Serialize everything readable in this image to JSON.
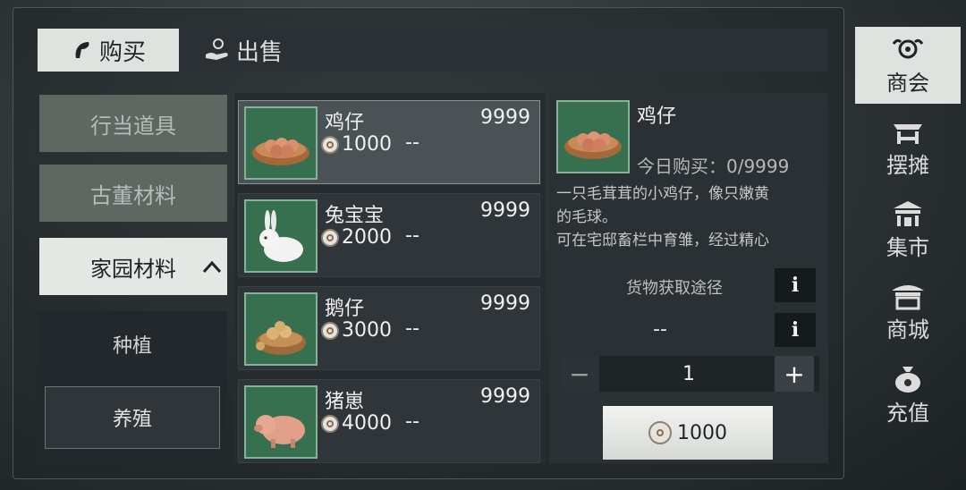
{
  "tabs": {
    "buy": "购买",
    "sell": "出售"
  },
  "categories": [
    {
      "label": "行当道具"
    },
    {
      "label": "古董材料"
    },
    {
      "label": "家园材料",
      "chevron": "^"
    }
  ],
  "subcategories": [
    {
      "label": "种植"
    },
    {
      "label": "养殖"
    }
  ],
  "items": [
    {
      "name": "鸡仔",
      "count": "9999",
      "price": "1000",
      "extra": "--"
    },
    {
      "name": "兔宝宝",
      "count": "9999",
      "price": "2000",
      "extra": "--"
    },
    {
      "name": "鹅仔",
      "count": "9999",
      "price": "3000",
      "extra": "--"
    },
    {
      "name": "猪崽",
      "count": "9999",
      "price": "4000",
      "extra": "--"
    }
  ],
  "detail": {
    "name": "鸡仔",
    "limit": "今日购买：0/9999",
    "desc_line1": "一只毛茸茸的小鸡仔，像只嫩黄",
    "desc_line2": "的毛球。",
    "desc_line3": "可在宅邸畜栏中育雏，经过精心",
    "source_label": "货物获取途径",
    "source_value": "--",
    "info_symbol": "i",
    "quantity": "1",
    "minus": "−",
    "plus": "+",
    "buy_price": "1000"
  },
  "sidebar": [
    {
      "label": "商会"
    },
    {
      "label": "摆摊"
    },
    {
      "label": "集市"
    },
    {
      "label": "商城"
    },
    {
      "label": "充值"
    }
  ],
  "colors": {
    "active_tab": "#dfe2df",
    "item_bg": "#37704e",
    "panel": "#2a3033"
  }
}
